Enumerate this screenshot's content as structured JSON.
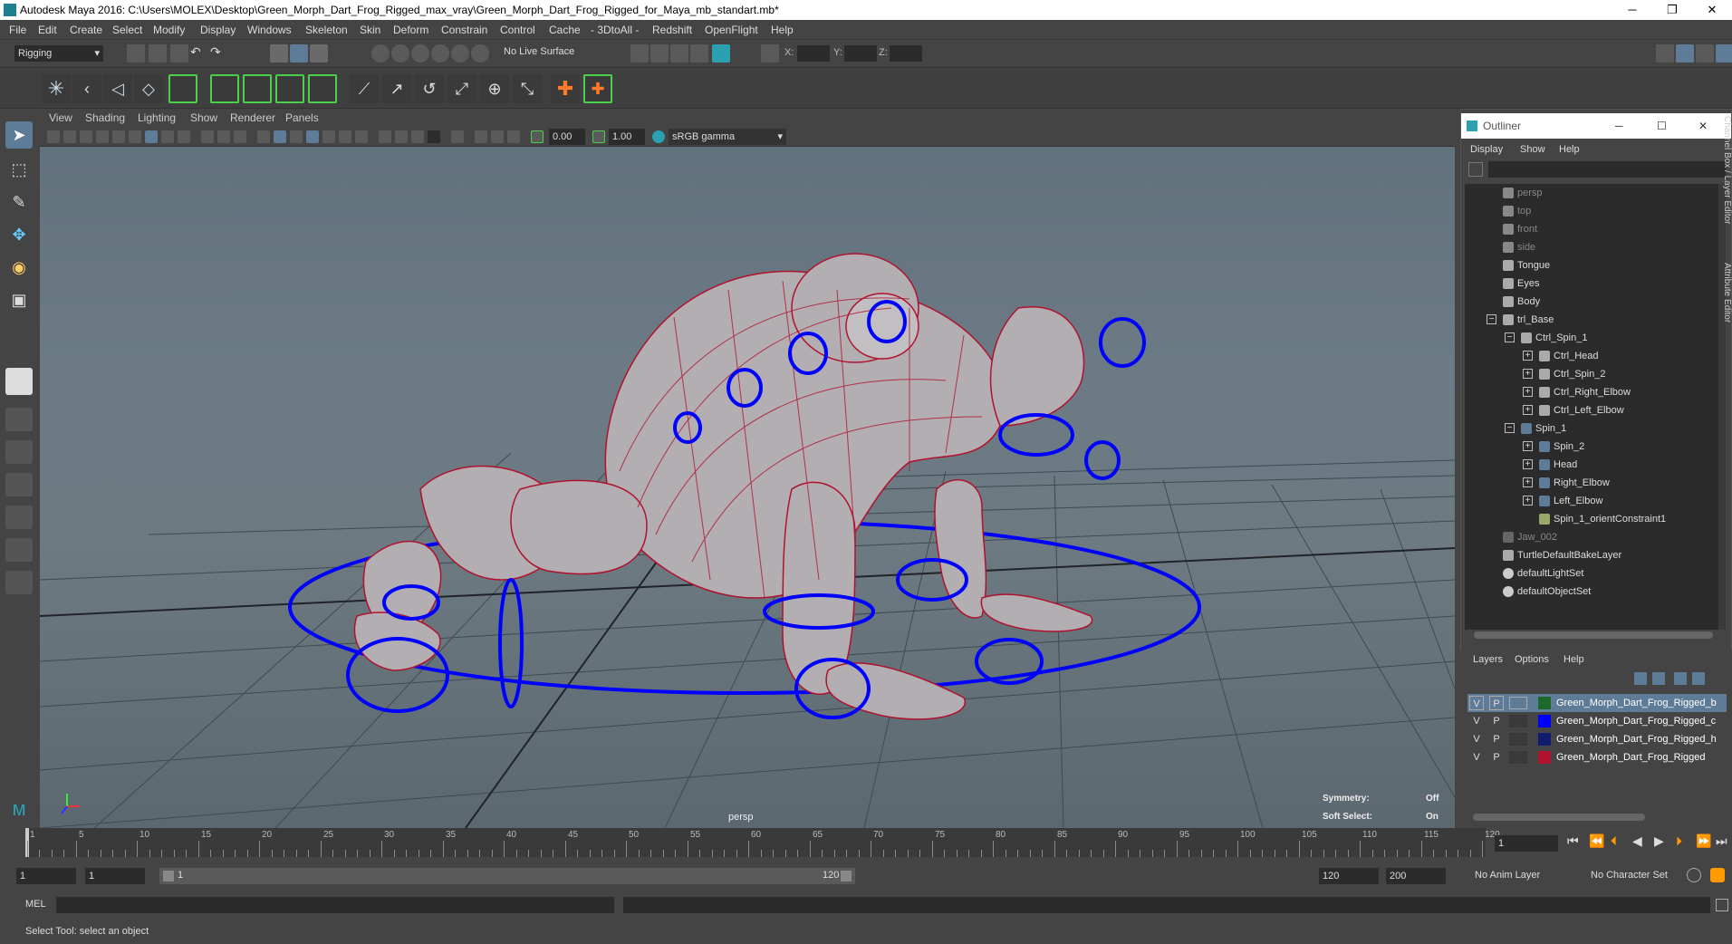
{
  "window": {
    "title": "Autodesk Maya 2016: C:\\Users\\MOLEX\\Desktop\\Green_Morph_Dart_Frog_Rigged_max_vray\\Green_Morph_Dart_Frog_Rigged_for_Maya_mb_standart.mb*",
    "minimize": "─",
    "restore": "❐",
    "close": "✕"
  },
  "menubar": [
    "File",
    "Edit",
    "Create",
    "Select",
    "Modify",
    "Display",
    "Windows",
    "Skeleton",
    "Skin",
    "Deform",
    "Constrain",
    "Control",
    "Cache",
    "- 3DtoAll -",
    "Redshift",
    "OpenFlight",
    "Help"
  ],
  "statusline": {
    "menuset": "Rigging",
    "live_surface": "No Live Surface",
    "x_label": "X:",
    "y_label": "Y:",
    "z_label": "Z:"
  },
  "viewport": {
    "menu": [
      "View",
      "Shading",
      "Lighting",
      "Show",
      "Renderer",
      "Panels"
    ],
    "exposure": "0.00",
    "gamma": "1.00",
    "colorspace": "sRGB gamma",
    "camera_label": "persp",
    "hud": {
      "symmetry_label": "Symmetry:",
      "symmetry_value": "Off",
      "softsel_label": "Soft Select:",
      "softsel_value": "On"
    }
  },
  "outliner": {
    "title": "Outliner",
    "min": "─",
    "max": "☐",
    "close": "✕",
    "menu": [
      "Display",
      "Show",
      "Help"
    ],
    "items": [
      {
        "label": "persp",
        "gray": true
      },
      {
        "label": "top",
        "gray": true
      },
      {
        "label": "front",
        "gray": true
      },
      {
        "label": "side",
        "gray": true
      },
      {
        "label": "Tongue",
        "gray": false
      },
      {
        "label": "Eyes",
        "gray": false
      },
      {
        "label": "Body",
        "gray": false
      },
      {
        "label": "trl_Base",
        "gray": false
      },
      {
        "label": "Ctrl_Spin_1",
        "gray": false
      },
      {
        "label": "Ctrl_Head",
        "gray": false
      },
      {
        "label": "Ctrl_Spin_2",
        "gray": false
      },
      {
        "label": "Ctrl_Right_Elbow",
        "gray": false
      },
      {
        "label": "Ctrl_Left_Elbow",
        "gray": false
      },
      {
        "label": "Spin_1",
        "gray": false
      },
      {
        "label": "Spin_2",
        "gray": false
      },
      {
        "label": "Head",
        "gray": false
      },
      {
        "label": "Right_Elbow",
        "gray": false
      },
      {
        "label": "Left_Elbow",
        "gray": false
      },
      {
        "label": "Spin_1_orientConstraint1",
        "gray": false
      },
      {
        "label": "Jaw_002",
        "gray": true
      },
      {
        "label": "TurtleDefaultBakeLayer",
        "gray": false
      },
      {
        "label": "defaultLightSet",
        "gray": false
      },
      {
        "label": "defaultObjectSet",
        "gray": false
      }
    ]
  },
  "side_tabs": {
    "channel_box": "Channel Box / Layer Editor",
    "attribute_editor": "Attribute Editor"
  },
  "layers": {
    "menu": [
      "Layers",
      "Options",
      "Help"
    ],
    "rows": [
      {
        "v": "V",
        "p": "P",
        "name": "Green_Morph_Dart_Frog_Rigged_b",
        "color": "#1a6b2a",
        "selected": true
      },
      {
        "v": "V",
        "p": "P",
        "name": "Green_Morph_Dart_Frog_Rigged_c",
        "color": "#0000ff",
        "selected": false
      },
      {
        "v": "V",
        "p": "P",
        "name": "Green_Morph_Dart_Frog_Rigged_h",
        "color": "#101c6e",
        "selected": false
      },
      {
        "v": "V",
        "p": "P",
        "name": "Green_Morph_Dart_Frog_Rigged",
        "color": "#b0122e",
        "selected": false
      }
    ]
  },
  "timeline": {
    "ticks": [
      "1",
      "5",
      "10",
      "15",
      "20",
      "25",
      "30",
      "35",
      "40",
      "45",
      "50",
      "55",
      "60",
      "65",
      "70",
      "75",
      "80",
      "85",
      "90",
      "95",
      "100",
      "105",
      "110",
      "115",
      "120"
    ],
    "current_frame": "1"
  },
  "range": {
    "start": "1",
    "anim_start": "1",
    "slider_start": "1",
    "slider_end": "120",
    "end": "120",
    "anim_end": "200",
    "anim_layer": "No Anim Layer",
    "char_set": "No Character Set"
  },
  "cmd": {
    "label": "MEL"
  },
  "help": {
    "text": "Select Tool: select an object"
  },
  "colors": {
    "rig_blue": "#0000ff",
    "wire_red": "#b0122e",
    "accent_teal": "#2aa0b0",
    "bg": "#444444"
  }
}
